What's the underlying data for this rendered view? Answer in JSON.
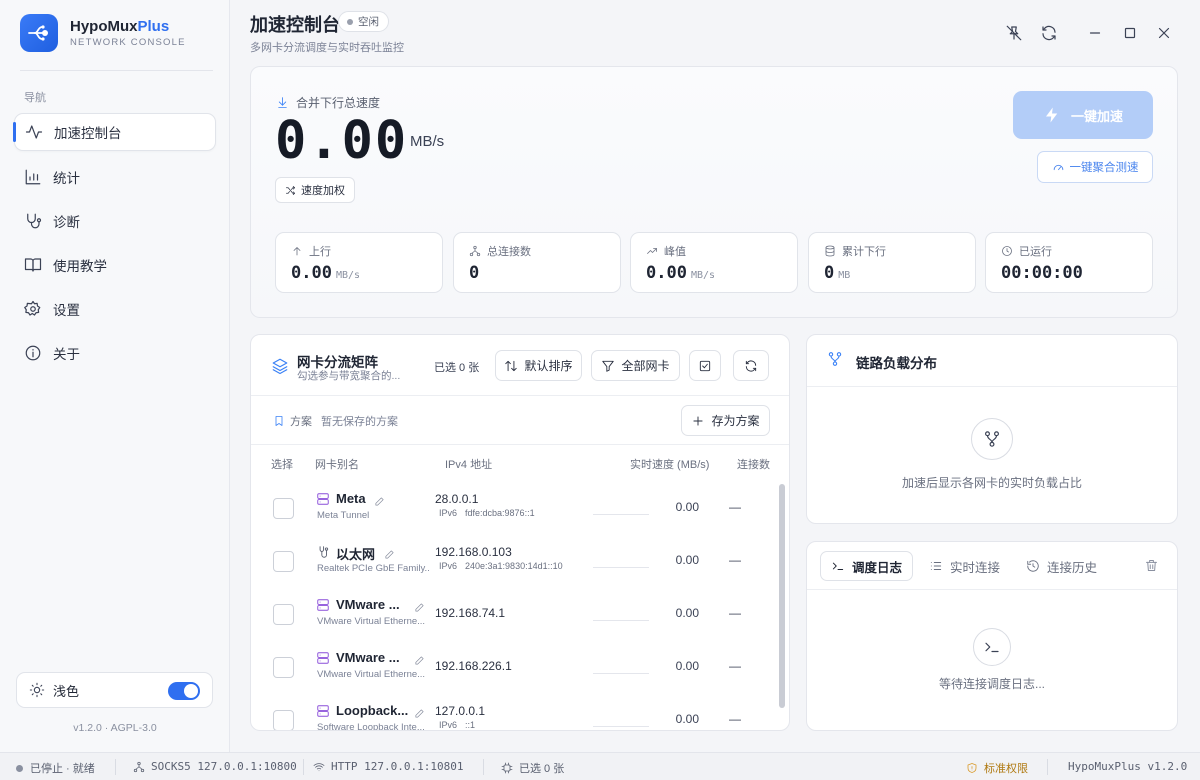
{
  "app": {
    "name": "HypoMux",
    "name_accent": "Plus",
    "subtitle": "NETWORK CONSOLE",
    "version": "v1.2.0 · AGPL-3.0"
  },
  "sidebar": {
    "section_label": "导航",
    "items": [
      {
        "label": "加速控制台",
        "icon": "activity-icon",
        "active": true
      },
      {
        "label": "统计",
        "icon": "bar-chart-icon"
      },
      {
        "label": "诊断",
        "icon": "stethoscope-icon"
      },
      {
        "label": "使用教学",
        "icon": "book-icon"
      },
      {
        "label": "设置",
        "icon": "gear-icon"
      },
      {
        "label": "关于",
        "icon": "info-icon"
      }
    ],
    "theme_label": "浅色",
    "theme_toggle_on": true
  },
  "header": {
    "title": "加速控制台",
    "status_badge": "空闲",
    "subtitle": "多网卡分流调度与实时吞吐监控"
  },
  "speed": {
    "label": "合并下行总速度",
    "value": "0.00",
    "unit": "MB/s",
    "weight_button": "速度加权",
    "boost_button": "一键加速",
    "test_button": "一键聚合测速",
    "stats": [
      {
        "label": "上行",
        "value": "0.00",
        "unit": "MB/s",
        "icon": "arrow-up-icon"
      },
      {
        "label": "总连接数",
        "value": "0",
        "unit": "",
        "icon": "network-icon"
      },
      {
        "label": "峰值",
        "value": "0.00",
        "unit": "MB/s",
        "icon": "trend-up-icon"
      },
      {
        "label": "累计下行",
        "value": "0",
        "unit": "MB",
        "icon": "database-icon"
      },
      {
        "label": "已运行",
        "value": "00:00:00",
        "unit": "",
        "icon": "clock-icon"
      }
    ]
  },
  "nics": {
    "title": "网卡分流矩阵",
    "subtitle": "勾选参与带宽聚合的...",
    "selected_count": "已选 0 张",
    "sort_button": "默认排序",
    "filter_button": "全部网卡",
    "plan_label": "方案",
    "plan_value": "暂无保存的方案",
    "save_plan_button": "存为方案",
    "columns": [
      "选择",
      "网卡别名",
      "IPv4 地址",
      "实时速度 (MB/s)",
      "连接数"
    ],
    "rows": [
      {
        "name": "Meta",
        "desc": "Meta Tunnel",
        "ipv4": "28.0.0.1",
        "ipv6_tag": "IPv6",
        "ipv6": "fdfe:dcba:9876::1",
        "speed": "0.00",
        "conns": "—",
        "icon": "server-icon"
      },
      {
        "name": "以太网",
        "desc": "Realtek PCIe GbE Family...",
        "ipv4": "192.168.0.103",
        "ipv6_tag": "IPv6",
        "ipv6": "240e:3a1:9830:14d1::10",
        "speed": "0.00",
        "conns": "—",
        "icon": "ethernet-icon"
      },
      {
        "name": "VMware ...",
        "desc": "VMware Virtual Etherne...",
        "ipv4": "192.168.74.1",
        "ipv6_tag": "",
        "ipv6": "",
        "speed": "0.00",
        "conns": "—",
        "icon": "server-icon"
      },
      {
        "name": "VMware ...",
        "desc": "VMware Virtual Etherne...",
        "ipv4": "192.168.226.1",
        "ipv6_tag": "",
        "ipv6": "",
        "speed": "0.00",
        "conns": "—",
        "icon": "server-icon"
      },
      {
        "name": "Loopback...",
        "desc": "Software Loopback Inte...",
        "ipv4": "127.0.0.1",
        "ipv6_tag": "IPv6",
        "ipv6": "::1",
        "speed": "0.00",
        "conns": "—",
        "icon": "server-icon"
      }
    ]
  },
  "load": {
    "title": "链路负载分布",
    "empty_text": "加速后显示各网卡的实时负载占比"
  },
  "log": {
    "tabs": [
      "调度日志",
      "实时连接",
      "连接历史"
    ],
    "empty_text": "等待连接调度日志..."
  },
  "status": {
    "state": "已停止 · 就绪",
    "socks": "SOCKS5 127.0.0.1:10800",
    "http": "HTTP 127.0.0.1:10801",
    "selected": "已选 0 张",
    "permission": "标准权限",
    "version": "HypoMuxPlus v1.2.0"
  },
  "colors": {
    "accent": "#2f6ff0",
    "boost_disabled": "#b3cdf8",
    "nic_icon": "#8a4fd9",
    "warning": "#d99a2b"
  }
}
